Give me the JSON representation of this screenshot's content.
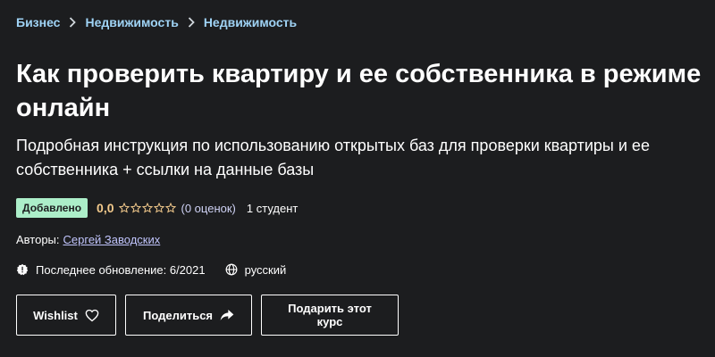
{
  "breadcrumb": {
    "items": [
      "Бизнес",
      "Недвижимость",
      "Недвижимость"
    ]
  },
  "course": {
    "title": "Как проверить квартиру и ее собственника в режиме онлайн",
    "subtitle": "Подробная инструкция по использованию открытых баз для проверки квартиры и ее собственника + ссылки на данные базы",
    "badge": "Добавлено",
    "rating_value": "0,0",
    "rating_stars_filled": 0,
    "rating_stars_total": 5,
    "rating_count": "(0 оценок)",
    "students": "1 студент",
    "authors_label": "Авторы:",
    "author_name": "Сергей Заводских",
    "last_updated": "Последнее обновление: 6/2021",
    "language": "русский"
  },
  "actions": {
    "wishlist_label": "Wishlist",
    "share_label": "Поделиться",
    "gift_label": "Подарить этот курс"
  },
  "colors": {
    "background": "#1c1d1f",
    "badge_bg": "#aceec9",
    "rating": "#f3ca8c",
    "link": "#c0c4fc"
  },
  "icons": {
    "breadcrumb_separator": "chevron-right-icon",
    "star": "star-outline-icon",
    "update": "alert-badge-icon",
    "language": "globe-icon",
    "wishlist": "heart-icon",
    "share": "share-arrow-icon"
  }
}
